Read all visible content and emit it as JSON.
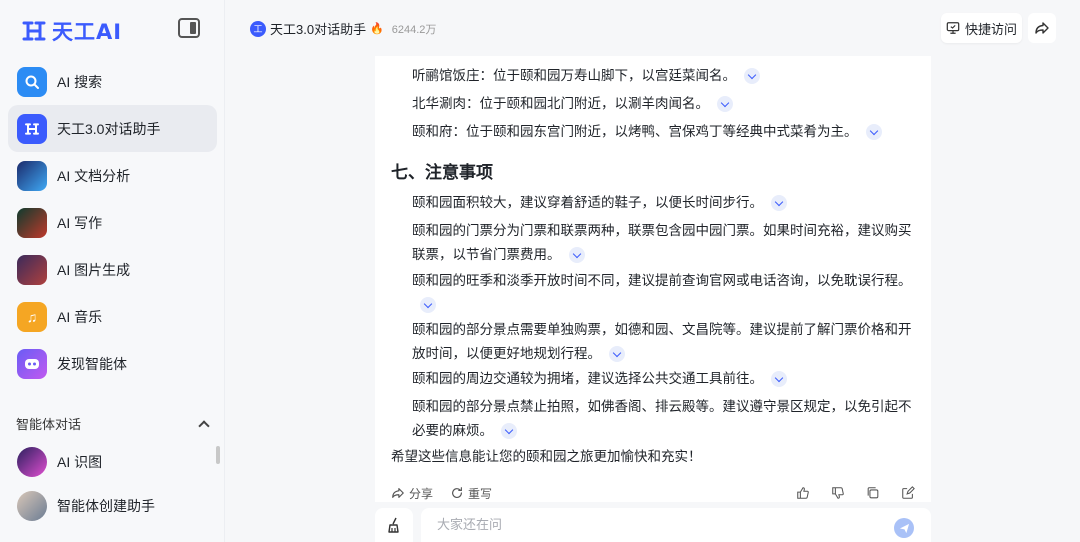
{
  "sidebar": {
    "logo_text": "天工AI",
    "nav": [
      {
        "label": "AI 搜索"
      },
      {
        "label": "天工3.0对话助手"
      },
      {
        "label": "AI 文档分析"
      },
      {
        "label": "AI 写作"
      },
      {
        "label": "AI 图片生成"
      },
      {
        "label": "AI 音乐"
      },
      {
        "label": "发现智能体"
      }
    ],
    "section_title": "智能体对话",
    "agents": [
      {
        "label": "AI 识图"
      },
      {
        "label": "智能体创建助手"
      }
    ]
  },
  "topbar": {
    "title": "天工3.0对话助手",
    "hot_count": "6244.2万",
    "quick_access": "快捷访问"
  },
  "article": {
    "items_top": [
      "听鹂馆饭庄：位于颐和园万寿山脚下，以宫廷菜闻名。",
      "北华涮肉：位于颐和园北门附近，以涮羊肉闻名。",
      "颐和府：位于颐和园东宫门附近，以烤鸭、宫保鸡丁等经典中式菜肴为主。"
    ],
    "heading": "七、注意事项",
    "notes": [
      "颐和园面积较大，建议穿着舒适的鞋子，以便长时间步行。",
      "颐和园的门票分为门票和联票两种，联票包含园中园门票。如果时间充裕，建议购买联票，以节省门票费用。",
      "颐和园的旺季和淡季开放时间不同，建议提前查询官网或电话咨询，以免耽误行程。",
      "颐和园的部分景点需要单独购票，如德和园、文昌院等。建议提前了解门票价格和开放时间，以便更好地规划行程。",
      "颐和园的周边交通较为拥堵，建议选择公共交通工具前往。",
      "颐和园的部分景点禁止拍照，如佛香阁、排云殿等。建议遵守景区规定，以免引起不必要的麻烦。"
    ],
    "closing": "希望这些信息能让您的颐和园之旅更加愉快和充实！"
  },
  "actions": {
    "share": "分享",
    "regenerate": "重写"
  },
  "input": {
    "placeholder": "大家还在问"
  }
}
